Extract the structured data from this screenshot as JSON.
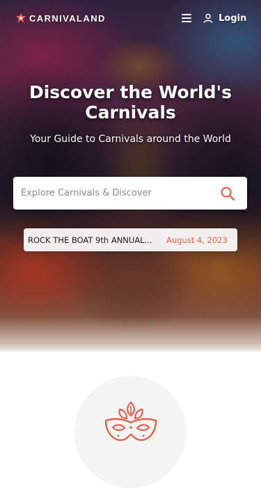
{
  "brand": {
    "name": "CARNIVALAND",
    "accent_color": "#e8604c"
  },
  "header": {
    "menu_icon": "hamburger-menu-icon",
    "login_icon": "user-icon",
    "login_label": "Login"
  },
  "hero": {
    "title": "Discover the World's Carnivals",
    "subtitle": "Your Guide to Carnivals around the World"
  },
  "search": {
    "placeholder": "Explore Carnivals & Discover",
    "icon": "search-icon"
  },
  "ticker": {
    "title": "ROCK THE BOAT 9th ANNUAL...",
    "date": "August 4, 2023"
  },
  "feature": {
    "icon": "carnival-mask-icon"
  }
}
